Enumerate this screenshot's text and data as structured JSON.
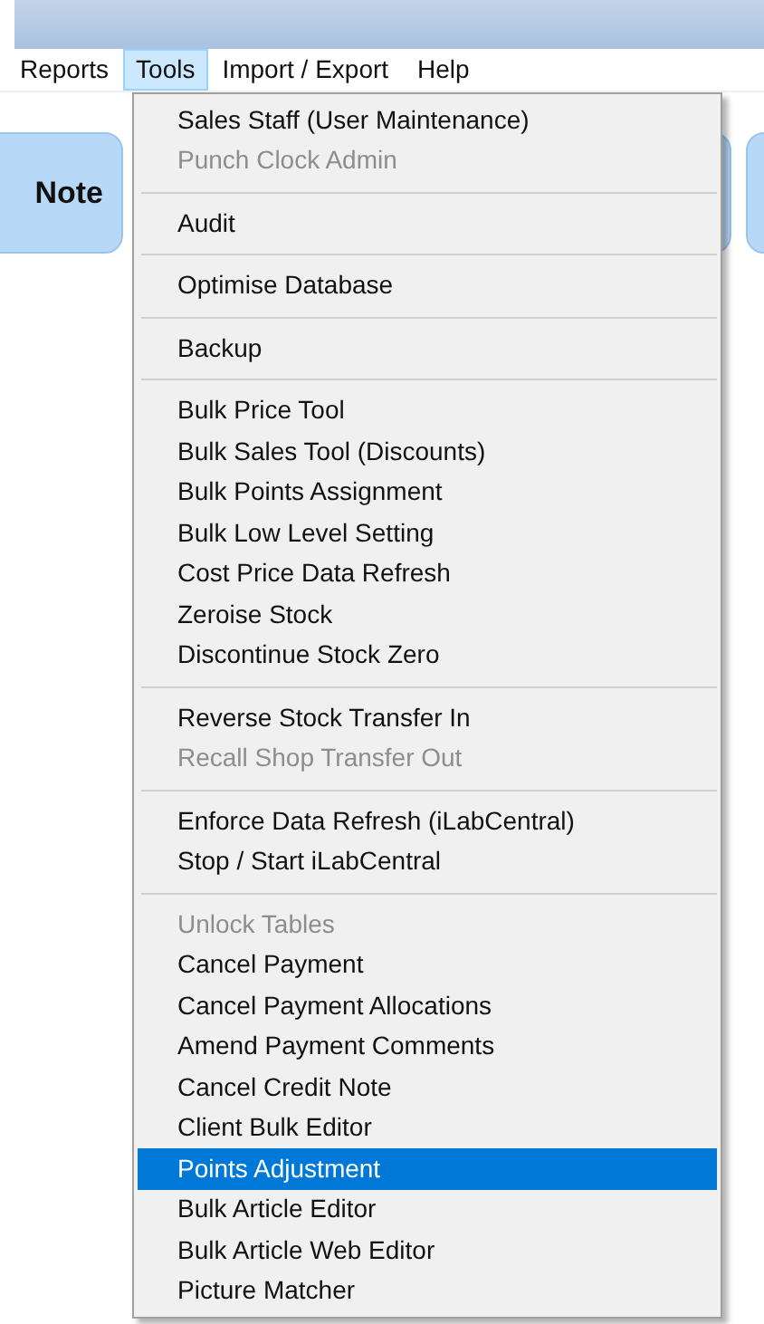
{
  "menu_bar": [
    {
      "label": "Reports",
      "selected": false
    },
    {
      "label": "Tools",
      "selected": true
    },
    {
      "label": "Import / Export",
      "selected": false
    },
    {
      "label": "Help",
      "selected": false
    }
  ],
  "background_tile": {
    "label": "Note"
  },
  "tools_menu": [
    {
      "kind": "item",
      "label": "Sales Staff (User Maintenance)",
      "disabled": false,
      "selected": false
    },
    {
      "kind": "item",
      "label": "Punch Clock Admin",
      "disabled": true,
      "selected": false
    },
    {
      "kind": "separator"
    },
    {
      "kind": "item",
      "label": "Audit",
      "disabled": false,
      "selected": false
    },
    {
      "kind": "separator"
    },
    {
      "kind": "item",
      "label": "Optimise Database",
      "disabled": false,
      "selected": false
    },
    {
      "kind": "separator"
    },
    {
      "kind": "item",
      "label": "Backup",
      "disabled": false,
      "selected": false
    },
    {
      "kind": "separator"
    },
    {
      "kind": "item",
      "label": "Bulk Price Tool",
      "disabled": false,
      "selected": false
    },
    {
      "kind": "item",
      "label": "Bulk Sales Tool (Discounts)",
      "disabled": false,
      "selected": false
    },
    {
      "kind": "item",
      "label": "Bulk Points Assignment",
      "disabled": false,
      "selected": false
    },
    {
      "kind": "item",
      "label": "Bulk Low Level Setting",
      "disabled": false,
      "selected": false
    },
    {
      "kind": "item",
      "label": "Cost Price Data Refresh",
      "disabled": false,
      "selected": false
    },
    {
      "kind": "item",
      "label": "Zeroise Stock",
      "disabled": false,
      "selected": false
    },
    {
      "kind": "item",
      "label": "Discontinue Stock Zero",
      "disabled": false,
      "selected": false
    },
    {
      "kind": "separator"
    },
    {
      "kind": "item",
      "label": "Reverse Stock Transfer In",
      "disabled": false,
      "selected": false
    },
    {
      "kind": "item",
      "label": "Recall Shop Transfer Out",
      "disabled": true,
      "selected": false
    },
    {
      "kind": "separator"
    },
    {
      "kind": "item",
      "label": "Enforce Data Refresh (iLabCentral)",
      "disabled": false,
      "selected": false
    },
    {
      "kind": "item",
      "label": "Stop / Start iLabCentral",
      "disabled": false,
      "selected": false
    },
    {
      "kind": "separator"
    },
    {
      "kind": "item",
      "label": "Unlock Tables",
      "disabled": true,
      "selected": false
    },
    {
      "kind": "item",
      "label": "Cancel Payment",
      "disabled": false,
      "selected": false
    },
    {
      "kind": "item",
      "label": "Cancel Payment Allocations",
      "disabled": false,
      "selected": false
    },
    {
      "kind": "item",
      "label": "Amend Payment Comments",
      "disabled": false,
      "selected": false
    },
    {
      "kind": "item",
      "label": "Cancel Credit Note",
      "disabled": false,
      "selected": false
    },
    {
      "kind": "item",
      "label": "Client Bulk Editor",
      "disabled": false,
      "selected": false
    },
    {
      "kind": "item",
      "label": "Points Adjustment",
      "disabled": false,
      "selected": true
    },
    {
      "kind": "item",
      "label": "Bulk Article Editor",
      "disabled": false,
      "selected": false
    },
    {
      "kind": "item",
      "label": "Bulk Article Web Editor",
      "disabled": false,
      "selected": false
    },
    {
      "kind": "item",
      "label": "Picture Matcher",
      "disabled": false,
      "selected": false
    }
  ]
}
